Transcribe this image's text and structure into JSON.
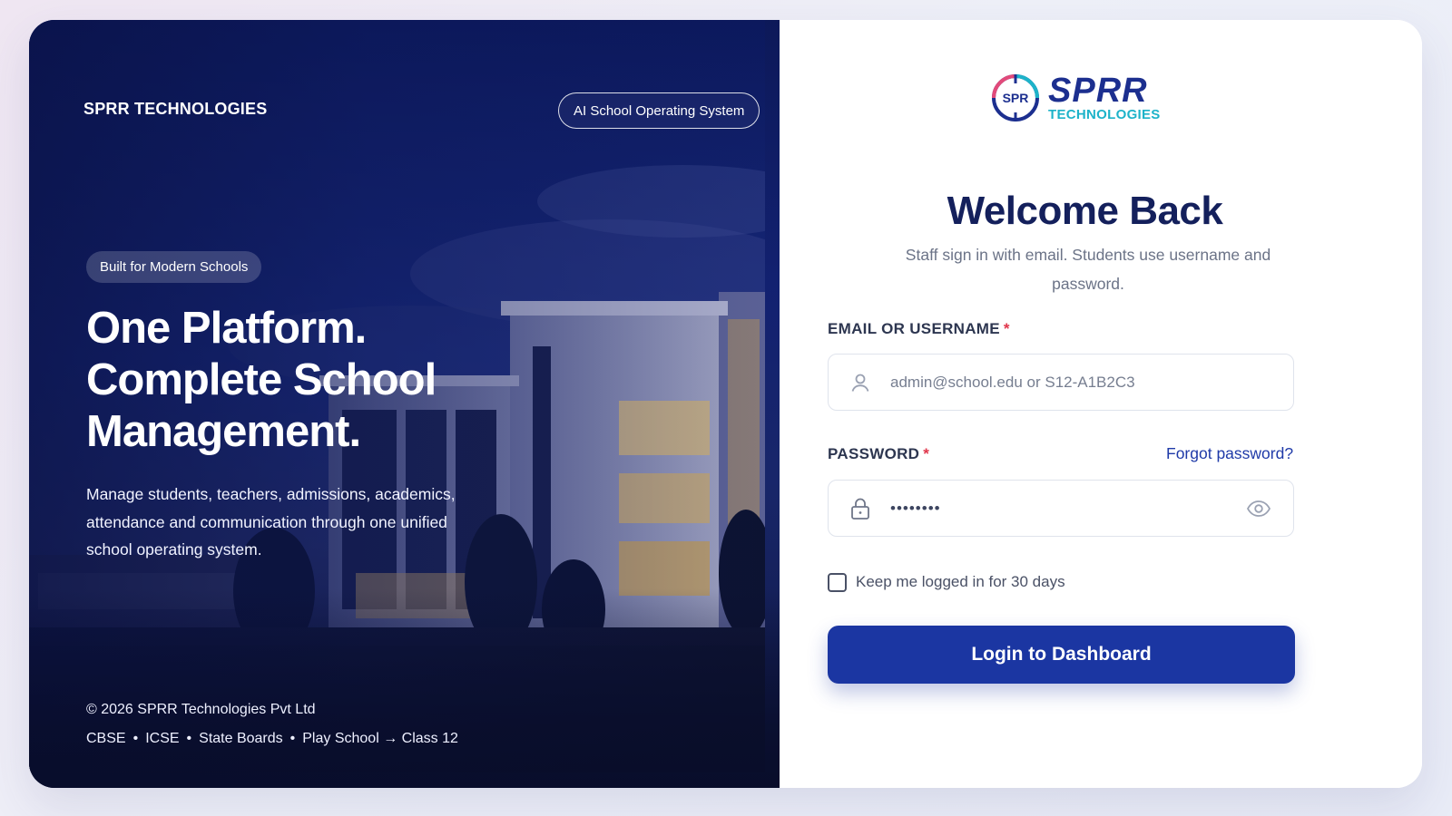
{
  "hero": {
    "brand": "SPRR TECHNOLOGIES",
    "system_badge": "AI School Operating System",
    "tag": "Built for Modern Schools",
    "headline": [
      "One Platform.",
      "Complete School",
      "Management."
    ],
    "description": "Manage students, teachers, admissions, academics, attendance and communication through one unified school operating system.",
    "copyright": "© 2026 SPRR Technologies Pvt Ltd",
    "boards": [
      "CBSE",
      "ICSE",
      "State Boards",
      "Play School → Class 12"
    ],
    "board_separator": "•"
  },
  "logo": {
    "mark_text": "SPR",
    "word": "SPRR",
    "sub": "TECHNOLOGIES"
  },
  "form": {
    "title": "Welcome Back",
    "subtitle": "Staff sign in with email. Students use username and password.",
    "email_label": "EMAIL OR USERNAME",
    "email_placeholder": "admin@school.edu or S12-A1B2C3",
    "password_label": "PASSWORD",
    "password_value": "••••••••",
    "required_marker": "*",
    "forgot_label": "Forgot password?",
    "remember_label": "Keep me logged in for 30 days",
    "remember_checked": false,
    "submit_label": "Login to Dashboard"
  },
  "icons": {
    "user": "user-icon",
    "lock": "lock-icon",
    "eye": "eye-icon",
    "logo": "sprr-logo-icon"
  },
  "colors": {
    "primary": "#1b36a2",
    "heading": "#14205c",
    "required": "#e0364b",
    "link": "#1f3aa8",
    "logo_teal": "#1db3c9"
  }
}
